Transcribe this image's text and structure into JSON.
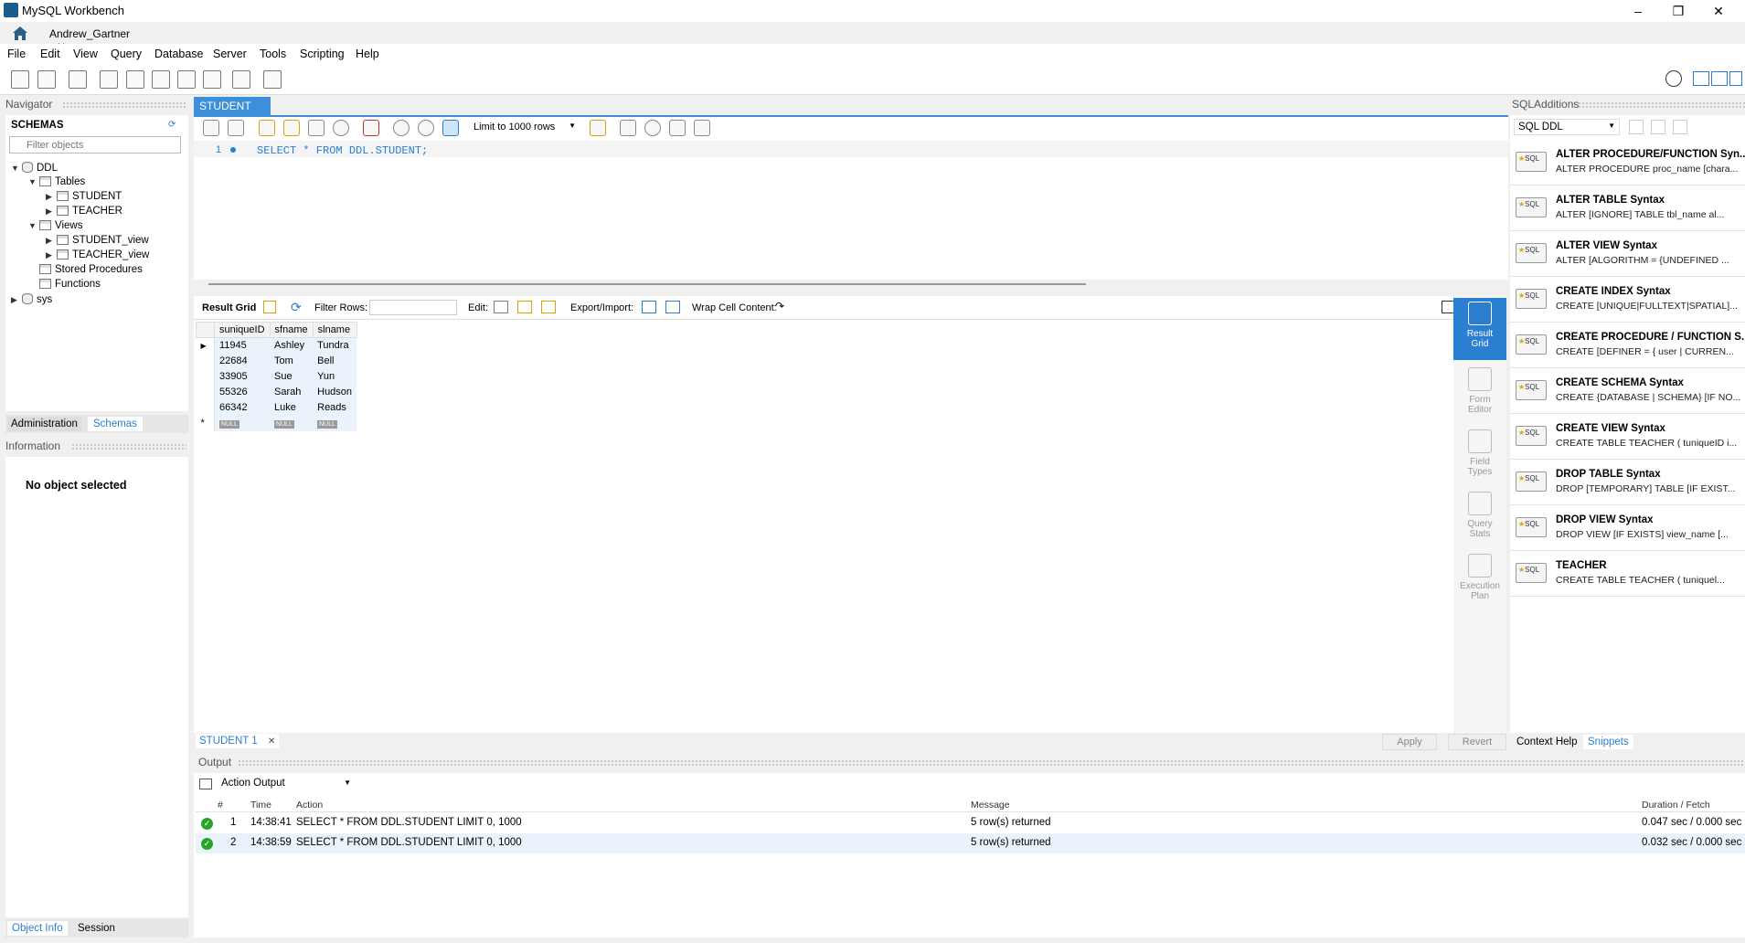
{
  "app": {
    "title": "MySQL Workbench"
  },
  "connection_tab": {
    "label": "Andrew_Gartner"
  },
  "menu": [
    "File",
    "Edit",
    "View",
    "Query",
    "Database",
    "Server",
    "Tools",
    "Scripting",
    "Help"
  ],
  "navigator": {
    "header": "Navigator",
    "schemas_label": "SCHEMAS",
    "filter_placeholder": "Filter objects",
    "tree": {
      "db": "DDL",
      "tables": "Tables",
      "table_items": [
        "STUDENT",
        "TEACHER"
      ],
      "views": "Views",
      "view_items": [
        "STUDENT_view",
        "TEACHER_view"
      ],
      "procedures": "Stored Procedures",
      "functions": "Functions",
      "sys": "sys"
    },
    "tabs": [
      "Administration",
      "Schemas"
    ],
    "info_header": "Information",
    "info_text": "No object selected",
    "bottom_tabs": [
      "Object Info",
      "Session"
    ]
  },
  "editor": {
    "tab_label": "STUDENT",
    "limit_label": "Limit to 1000 rows",
    "line_number": "1",
    "code": "SELECT * FROM DDL.STUDENT;"
  },
  "result": {
    "toolbar": {
      "grid_label": "Result Grid",
      "filter_label": "Filter Rows:",
      "edit_label": "Edit:",
      "export_label": "Export/Import:",
      "wrap_label": "Wrap Cell Content:"
    },
    "columns": [
      "suniqueID",
      "sfname",
      "slname"
    ],
    "rows": [
      [
        "11945",
        "Ashley",
        "Tundra"
      ],
      [
        "22684",
        "Tom",
        "Bell"
      ],
      [
        "33905",
        "Sue",
        "Yun"
      ],
      [
        "55326",
        "Sarah",
        "Hudson"
      ],
      [
        "66342",
        "Luke",
        "Reads"
      ]
    ],
    "null_label": "NULL",
    "tab_label": "STUDENT 1",
    "apply_label": "Apply",
    "revert_label": "Revert"
  },
  "side_tabs": [
    {
      "l1": "Result",
      "l2": "Grid"
    },
    {
      "l1": "Form",
      "l2": "Editor"
    },
    {
      "l1": "Field",
      "l2": "Types"
    },
    {
      "l1": "Query",
      "l2": "Stats"
    },
    {
      "l1": "Execution",
      "l2": "Plan"
    }
  ],
  "sql_additions": {
    "header": "SQLAdditions",
    "dropdown": "SQL DDL",
    "badge": "SQL",
    "snippets": [
      {
        "title": "ALTER PROCEDURE/FUNCTION Syn...",
        "desc": "ALTER PROCEDURE proc_name [chara..."
      },
      {
        "title": "ALTER TABLE Syntax",
        "desc": "ALTER [IGNORE] TABLE tbl_name    al..."
      },
      {
        "title": "ALTER VIEW Syntax",
        "desc": "ALTER     [ALGORITHM = {UNDEFINED ..."
      },
      {
        "title": "CREATE INDEX Syntax",
        "desc": "CREATE [UNIQUE|FULLTEXT|SPATIAL]..."
      },
      {
        "title": "CREATE PROCEDURE / FUNCTION S...",
        "desc": "CREATE     [DEFINER = { user | CURREN..."
      },
      {
        "title": "CREATE SCHEMA Syntax",
        "desc": "CREATE {DATABASE | SCHEMA} [IF NO..."
      },
      {
        "title": "CREATE VIEW Syntax",
        "desc": "CREATE TABLE TEACHER ( tuniqueID i..."
      },
      {
        "title": "DROP TABLE Syntax",
        "desc": "DROP [TEMPORARY] TABLE [IF EXIST..."
      },
      {
        "title": "DROP VIEW Syntax",
        "desc": "DROP VIEW [IF EXISTS]     view_name [..."
      },
      {
        "title": "TEACHER",
        "desc": "CREATE TABLE TEACHER (     tuniquel..."
      }
    ],
    "bottom_tabs": [
      "Context Help",
      "Snippets"
    ]
  },
  "output": {
    "header": "Output",
    "selector": "Action Output",
    "columns": {
      "num": "#",
      "time": "Time",
      "action": "Action",
      "message": "Message",
      "duration": "Duration / Fetch"
    },
    "rows": [
      {
        "num": "1",
        "time": "14:38:41",
        "action": "SELECT * FROM DDL.STUDENT LIMIT 0, 1000",
        "message": "5 row(s) returned",
        "duration": "0.047 sec / 0.000 sec"
      },
      {
        "num": "2",
        "time": "14:38:59",
        "action": "SELECT * FROM DDL.STUDENT LIMIT 0, 1000",
        "message": "5 row(s) returned",
        "duration": "0.032 sec / 0.000 sec"
      }
    ]
  }
}
